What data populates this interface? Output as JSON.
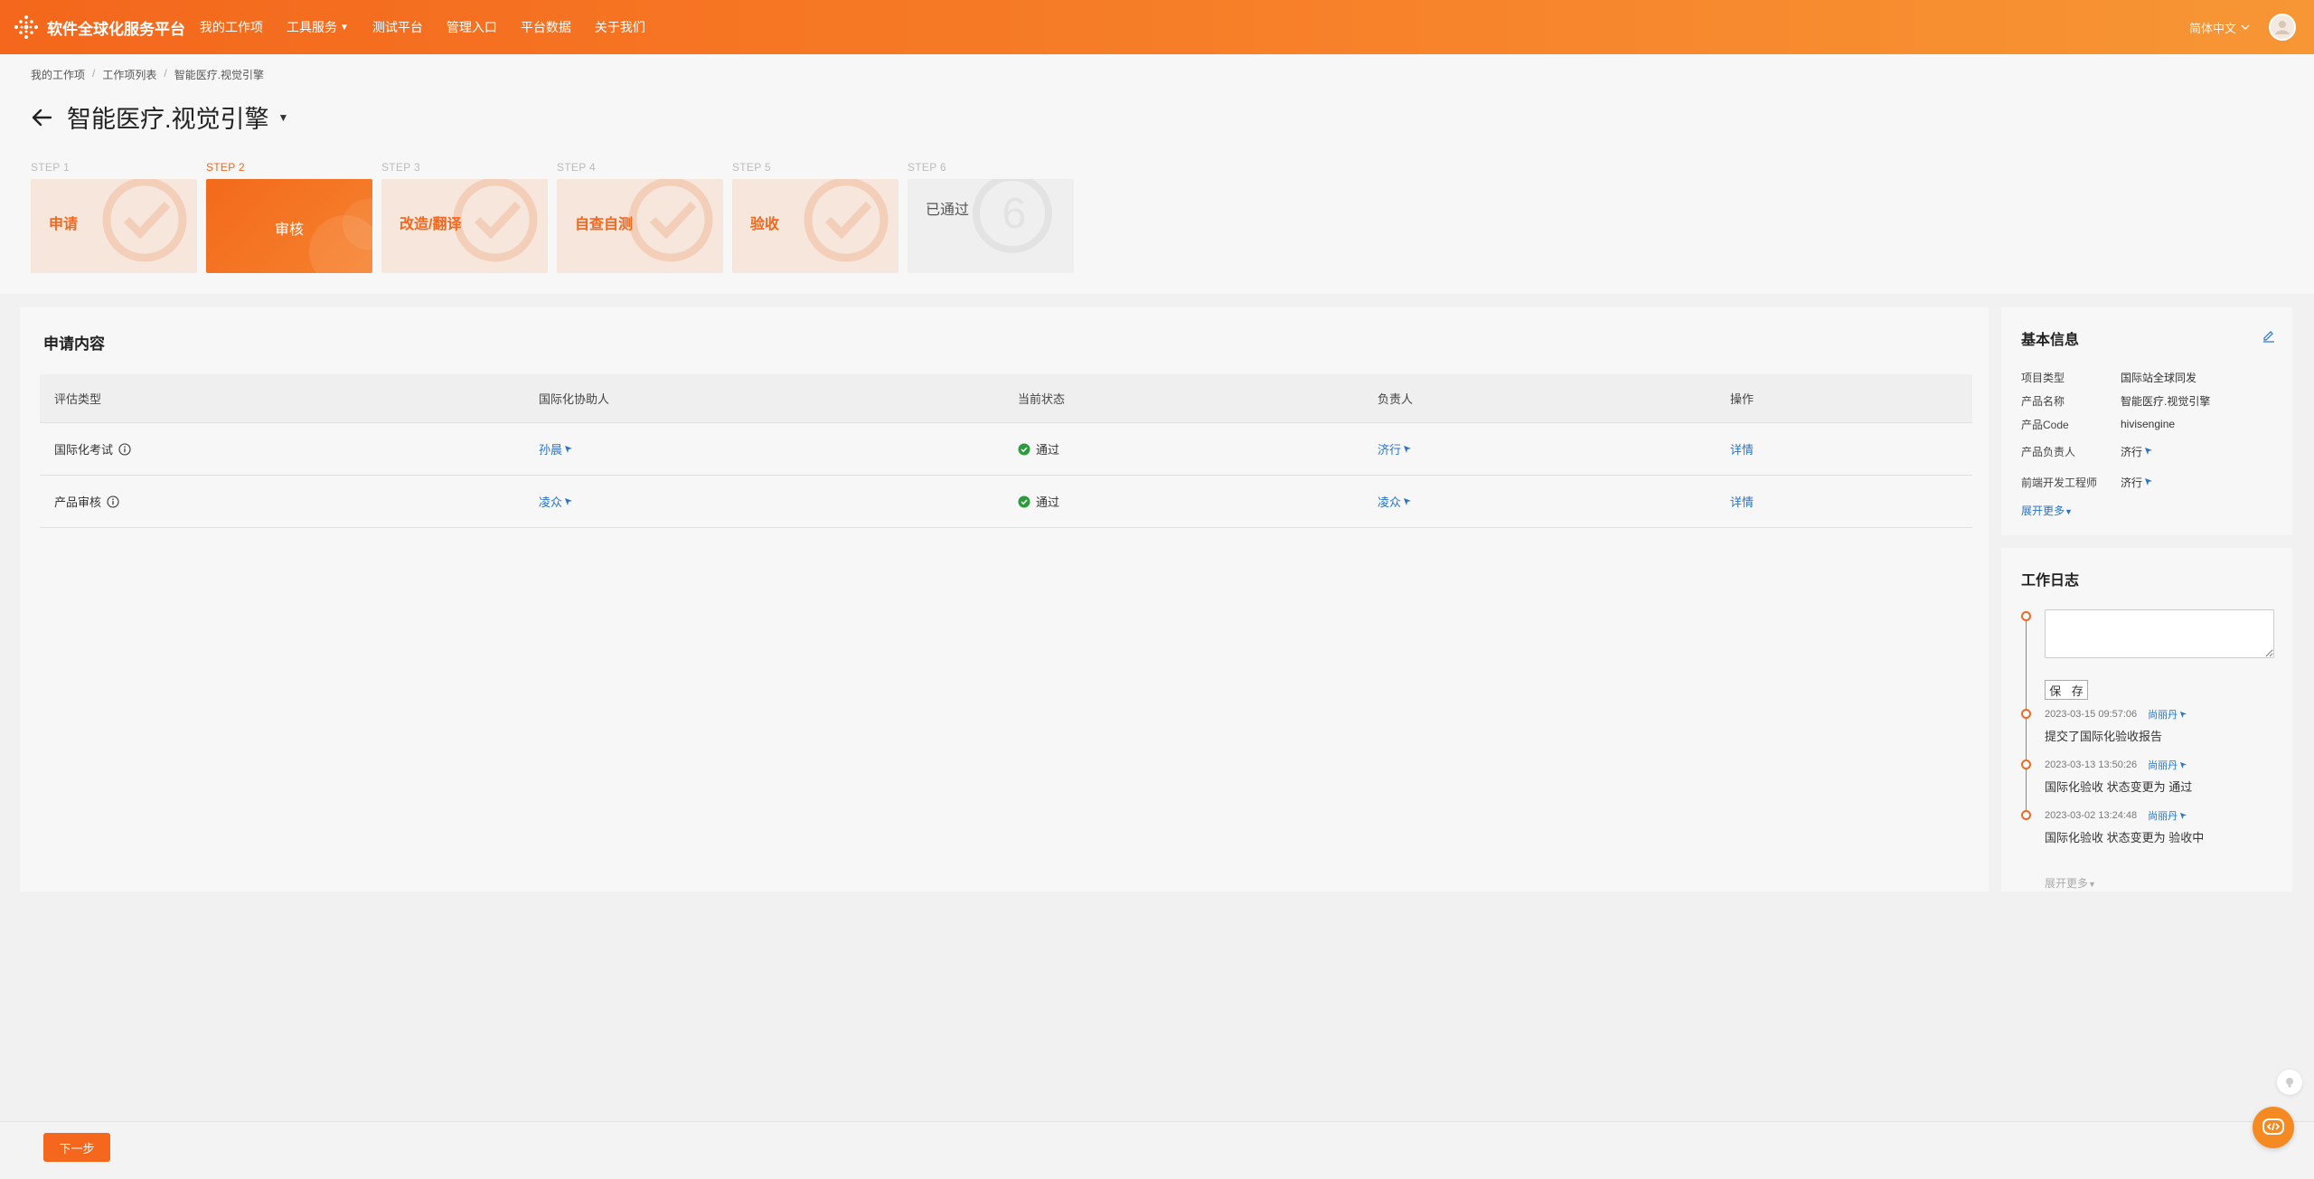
{
  "app": {
    "title": "软件全球化服务平台",
    "nav": [
      "我的工作项",
      "工具服务",
      "测试平台",
      "管理入口",
      "平台数据",
      "关于我们"
    ],
    "language": "简体中文"
  },
  "breadcrumb": [
    "我的工作项",
    "工作项列表",
    "智能医疗.视觉引擎"
  ],
  "page_title": "智能医疗.视觉引擎",
  "steps": [
    {
      "label": "STEP 1",
      "name": "申请"
    },
    {
      "label": "STEP 2",
      "name": "审核"
    },
    {
      "label": "STEP 3",
      "name": "改造/翻译"
    },
    {
      "label": "STEP 4",
      "name": "自查自测"
    },
    {
      "label": "STEP 5",
      "name": "验收"
    },
    {
      "label": "STEP 6",
      "name": "已通过"
    }
  ],
  "step6_number": "6",
  "application": {
    "title": "申请内容",
    "columns": [
      "评估类型",
      "国际化协助人",
      "当前状态",
      "负责人",
      "操作"
    ],
    "rows": [
      {
        "type": "国际化考试",
        "assistant": "孙晨",
        "status": "通过",
        "owner": "济行",
        "action": "详情"
      },
      {
        "type": "产品审核",
        "assistant": "凌众",
        "status": "通过",
        "owner": "凌众",
        "action": "详情"
      }
    ]
  },
  "basic_info": {
    "title": "基本信息",
    "rows": [
      {
        "key": "项目类型",
        "value": "国际站全球同发"
      },
      {
        "key": "产品名称",
        "value": "智能医疗.视觉引擎"
      },
      {
        "key": "产品Code",
        "value": "hivisengine"
      },
      {
        "key": "产品负责人",
        "value": "济行"
      },
      {
        "key": "前端开发工程师",
        "value": "济行"
      }
    ],
    "expand": "展开更多"
  },
  "work_log": {
    "title": "工作日志",
    "save_label": "保 存",
    "entries": [
      {
        "time": "2023-03-15 09:57:06",
        "user": "尚丽丹",
        "text": "提交了国际化验收报告"
      },
      {
        "time": "2023-03-13 13:50:26",
        "user": "尚丽丹",
        "text": "国际化验收 状态变更为 通过"
      },
      {
        "time": "2023-03-02 13:24:48",
        "user": "尚丽丹",
        "text": "国际化验收 状态变更为 验收中"
      }
    ],
    "expand": "展开更多"
  },
  "footer": {
    "next_label": "下一步"
  },
  "colors": {
    "accent": "#f4671c",
    "link": "#2a73c6",
    "success": "#2e9a3e"
  }
}
